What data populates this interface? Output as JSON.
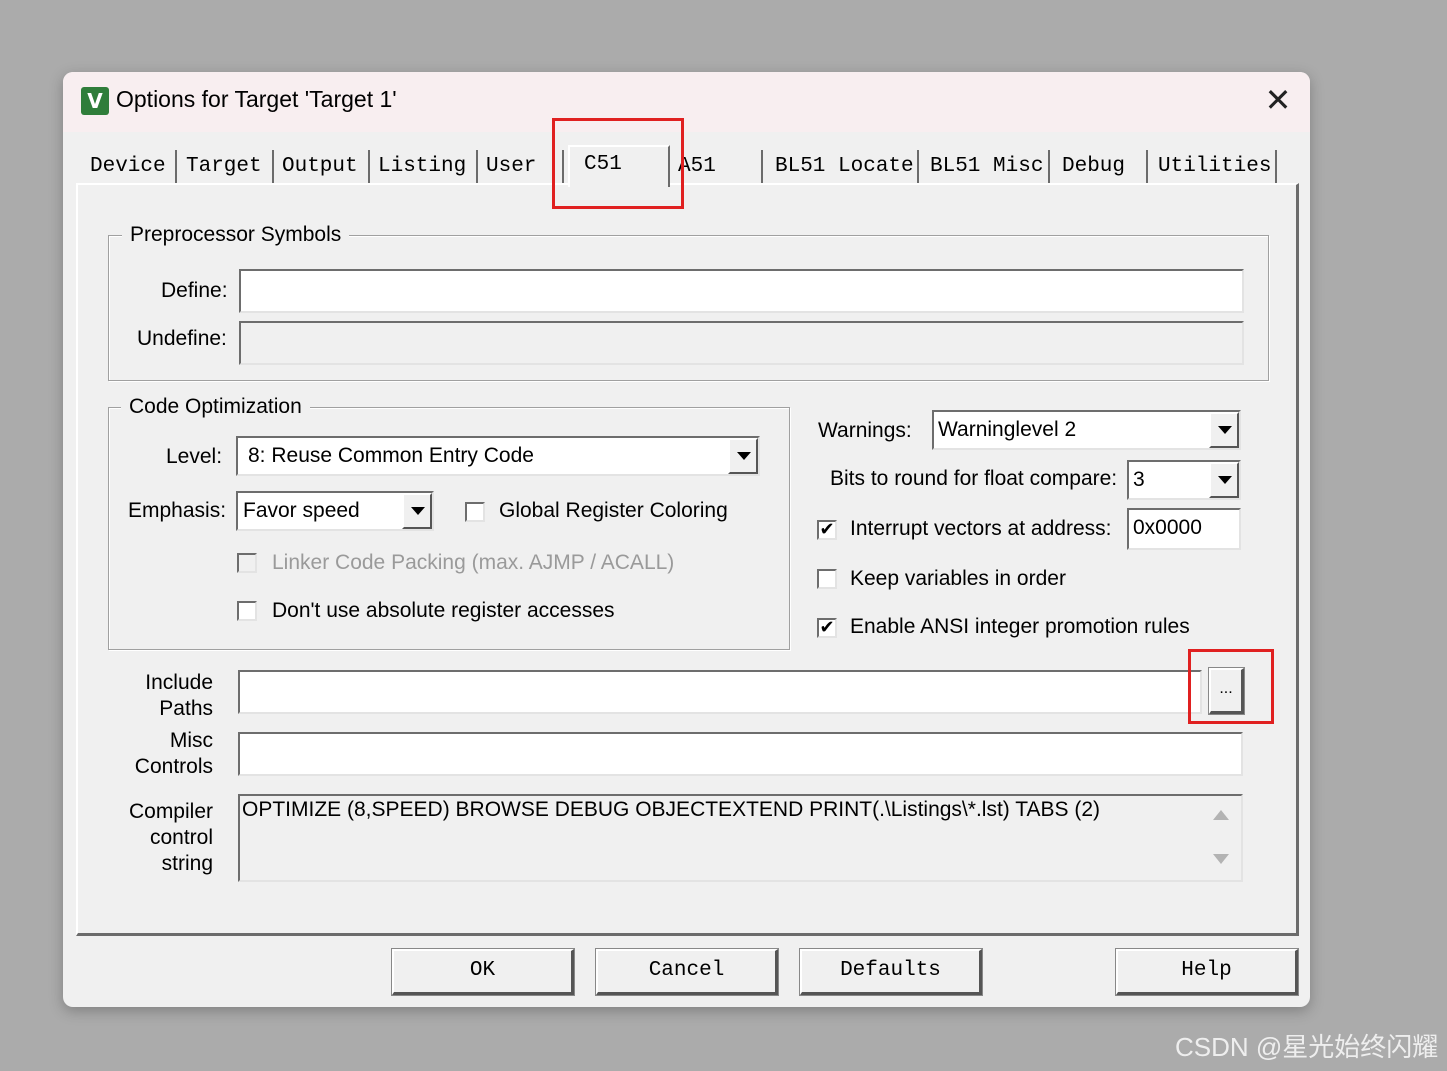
{
  "window": {
    "title": "Options for Target 'Target 1'",
    "app_icon_text": "V",
    "close_glyph": "✕"
  },
  "tabs": [
    {
      "label": "Device"
    },
    {
      "label": "Target"
    },
    {
      "label": "Output"
    },
    {
      "label": "Listing"
    },
    {
      "label": "User"
    },
    {
      "label": "C51",
      "active": true
    },
    {
      "label": "A51"
    },
    {
      "label": "BL51 Locate"
    },
    {
      "label": "BL51 Misc"
    },
    {
      "label": "Debug"
    },
    {
      "label": "Utilities"
    }
  ],
  "preprocessor": {
    "title": "Preprocessor Symbols",
    "define_label": "Define:",
    "define_value": "",
    "undefine_label": "Undefine:",
    "undefine_value": ""
  },
  "code_optimization": {
    "title": "Code Optimization",
    "level_label": "Level:",
    "level_value": "8: Reuse Common Entry Code",
    "emphasis_label": "Emphasis:",
    "emphasis_value": "Favor speed",
    "global_register_coloring": {
      "label": "Global Register Coloring",
      "checked": false
    },
    "linker_code_packing": {
      "label": "Linker Code Packing (max. AJMP / ACALL)",
      "checked": false,
      "disabled": true
    },
    "dont_use_absolute": {
      "label": "Don't use absolute register accesses",
      "checked": false
    }
  },
  "right_options": {
    "warnings_label": "Warnings:",
    "warnings_value": "Warninglevel 2",
    "bits_label": "Bits to round for float compare:",
    "bits_value": "3",
    "interrupt_vectors": {
      "label": "Interrupt vectors at address:",
      "checked": true,
      "value": "0x0000"
    },
    "keep_variables": {
      "label": "Keep variables in order",
      "checked": false
    },
    "ansi_promotion": {
      "label": "Enable ANSI integer promotion rules",
      "checked": true
    }
  },
  "paths": {
    "include_label": "Include\nPaths",
    "include_value": "",
    "browse_label": "...",
    "misc_label": "Misc\nControls",
    "misc_value": "",
    "compiler_label": "Compiler\ncontrol\nstring",
    "compiler_value": "OPTIMIZE (8,SPEED) BROWSE DEBUG OBJECTEXTEND PRINT(.\\Listings\\*.lst) TABS (2)"
  },
  "buttons": {
    "ok": "OK",
    "cancel": "Cancel",
    "defaults": "Defaults",
    "help": "Help"
  },
  "check_glyph": "✔",
  "colors": {
    "highlight": "#e02020",
    "dialog_bg": "#f0f0f0",
    "titlebar_bg": "#f8eef0",
    "desktop_bg": "#ababab"
  },
  "watermark": "CSDN @星光始终闪耀"
}
